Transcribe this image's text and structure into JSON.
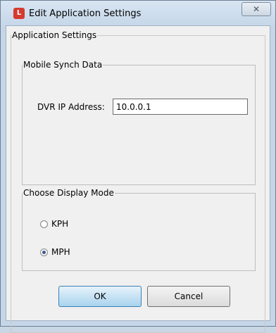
{
  "window": {
    "title": "Edit Application Settings",
    "icon_glyph": "L",
    "close_glyph": "✕"
  },
  "app_settings": {
    "legend": "Application Settings"
  },
  "mobile_synch": {
    "legend": "Mobile Synch Data",
    "dvr_ip_label": "DVR IP Address:",
    "dvr_ip_value": "10.0.0.1"
  },
  "display_mode": {
    "legend": "Choose Display Mode",
    "options": [
      {
        "label": "KPH",
        "checked": false
      },
      {
        "label": "MPH",
        "checked": true
      }
    ]
  },
  "buttons": {
    "ok": "OK",
    "cancel": "Cancel"
  },
  "colors": {
    "accent": "#3c7fb1",
    "app_icon": "#d63a2f"
  }
}
